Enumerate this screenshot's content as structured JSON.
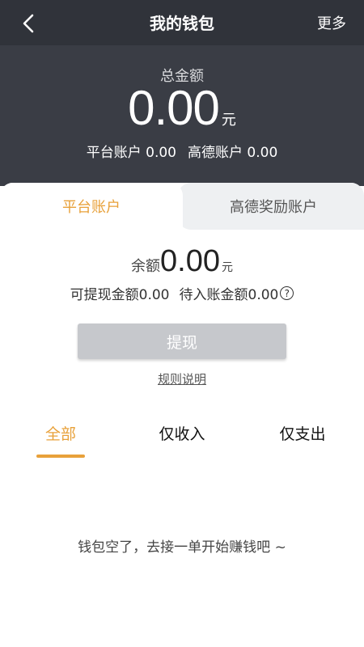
{
  "nav": {
    "title": "我的钱包",
    "more_label": "更多"
  },
  "summary": {
    "total_label": "总金额",
    "total_value": "0.00",
    "total_unit": "元",
    "platform_account": "平台账户 0.00",
    "gaode_account": "高德账户 0.00"
  },
  "account_tabs": [
    {
      "label": "平台账户",
      "active": true
    },
    {
      "label": "高德奖励账户",
      "active": false
    }
  ],
  "balance": {
    "label": "余额",
    "value": "0.00",
    "unit": "元",
    "withdrawable": "可提现金额0.00",
    "pending": "待入账金额0.00",
    "help_icon": "?"
  },
  "withdraw_label": "提现",
  "rules_label": "规则说明",
  "filter_tabs": [
    {
      "label": "全部",
      "active": true
    },
    {
      "label": "仅收入",
      "active": false
    },
    {
      "label": "仅支出",
      "active": false
    }
  ],
  "empty_message": "钱包空了，去接一单开始赚钱吧 ~",
  "colors": {
    "header_bg": "#3a3d45",
    "accent": "#e8a13a",
    "button_disabled": "#c6c8cc"
  }
}
